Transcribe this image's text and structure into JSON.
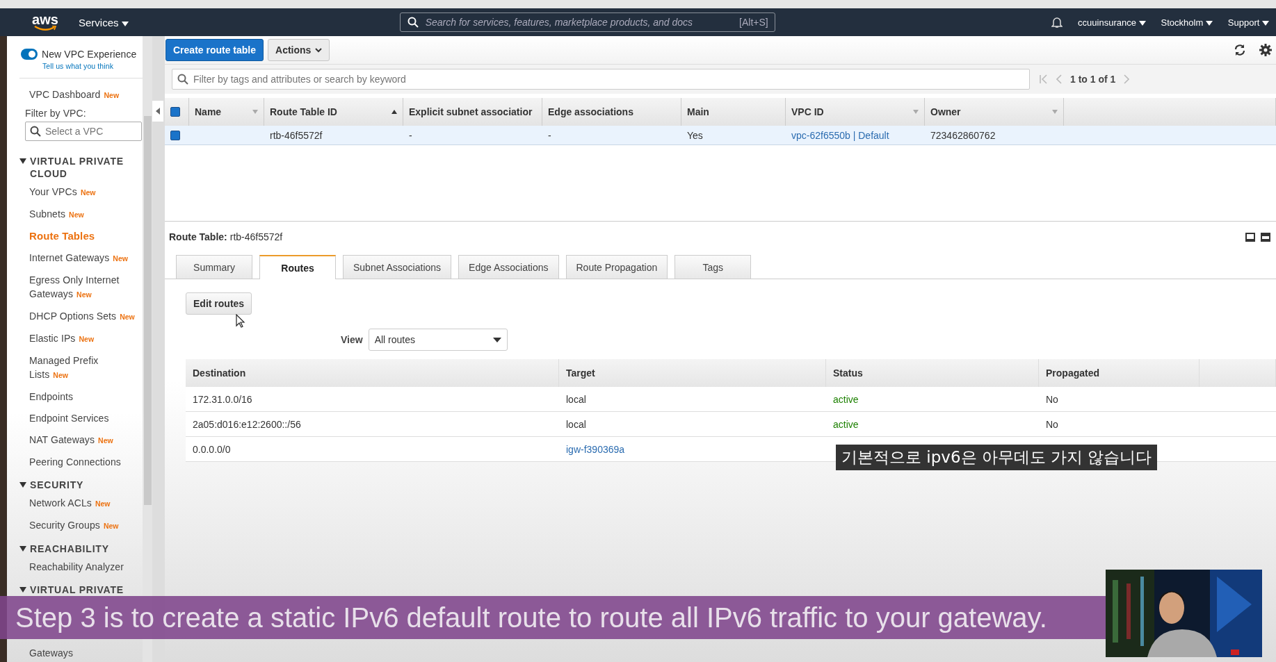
{
  "nav": {
    "logo": "aws",
    "services": "Services",
    "search": {
      "placeholder": "Search for services, features, marketplace products, and docs",
      "shortcut": "[Alt+S]"
    },
    "menus": [
      "ccuuinsurance",
      "Stockholm",
      "Support"
    ]
  },
  "sidebar": {
    "toggle": {
      "label": "New VPC Experience",
      "on": true
    },
    "feedback_link": "Tell us what you think",
    "items": [
      {
        "kind": "link",
        "label": "VPC Dashboard",
        "badge": "New",
        "selected": false
      },
      {
        "kind": "label",
        "label": "Filter by VPC:"
      },
      {
        "kind": "filter",
        "placeholder": "Select a VPC"
      },
      {
        "kind": "section",
        "label": "VIRTUAL PRIVATE CLOUD",
        "expanded": true
      },
      {
        "kind": "link",
        "label": "Your VPCs",
        "badge": "New",
        "selected": false
      },
      {
        "kind": "link",
        "label": "Subnets",
        "badge": "New",
        "selected": false
      },
      {
        "kind": "link",
        "label": "Route Tables",
        "selected": true
      },
      {
        "kind": "link",
        "label": "Internet Gateways",
        "badge": "New",
        "selected": false
      },
      {
        "kind": "link",
        "label": "Egress Only Internet Gateways",
        "badge": "New",
        "selected": false
      },
      {
        "kind": "link",
        "label": "DHCP Options Sets",
        "badge": "New",
        "selected": false
      },
      {
        "kind": "link",
        "label": "Elastic IPs",
        "badge": "New",
        "selected": false
      },
      {
        "kind": "link",
        "label": "Managed Prefix Lists",
        "badge": "New",
        "selected": false
      },
      {
        "kind": "link",
        "label": "Endpoints",
        "selected": false
      },
      {
        "kind": "link",
        "label": "Endpoint Services",
        "selected": false
      },
      {
        "kind": "link",
        "label": "NAT Gateways",
        "badge": "New",
        "selected": false
      },
      {
        "kind": "link",
        "label": "Peering Connections",
        "selected": false
      },
      {
        "kind": "section",
        "label": "SECURITY",
        "expanded": true
      },
      {
        "kind": "link",
        "label": "Network ACLs",
        "badge": "New",
        "selected": false
      },
      {
        "kind": "link",
        "label": "Security Groups",
        "badge": "New",
        "selected": false
      },
      {
        "kind": "section",
        "label": "REACHABILITY",
        "expanded": true
      },
      {
        "kind": "link",
        "label": "Reachability Analyzer",
        "selected": false
      },
      {
        "kind": "section",
        "label": "VIRTUAL PRIVATE",
        "expanded": true
      },
      {
        "kind": "link",
        "label": "Gateways",
        "selected": false
      }
    ]
  },
  "toolbar": {
    "create_button": "Create route table",
    "actions_button": "Actions"
  },
  "filter": {
    "placeholder": "Filter by tags and attributes or search by keyword",
    "pager": "1 to 1 of 1"
  },
  "table": {
    "all_checked": true,
    "columns": [
      {
        "label": "Name",
        "sortable": true,
        "sorted": false
      },
      {
        "label": "Route Table ID",
        "sortable": true,
        "sorted": true
      },
      {
        "label": "Explicit subnet associatior",
        "sortable": false
      },
      {
        "label": "Edge associations",
        "sortable": false
      },
      {
        "label": "Main",
        "sortable": false
      },
      {
        "label": "VPC ID",
        "sortable": true,
        "sorted": false
      },
      {
        "label": "Owner",
        "sortable": true,
        "sorted": false
      }
    ],
    "rows": [
      {
        "selected": true,
        "checked": true,
        "cells": [
          "",
          "rtb-46f5572f",
          "-",
          "-",
          "Yes",
          "vpc-62f6550b | Default",
          "723462860762"
        ]
      }
    ]
  },
  "details": {
    "label": "Route Table:",
    "value": "rtb-46f5572f",
    "tabs": [
      {
        "label": "Summary",
        "selected": false
      },
      {
        "label": "Routes",
        "selected": true
      },
      {
        "label": "Subnet Associations",
        "selected": false
      },
      {
        "label": "Edge Associations",
        "selected": false
      },
      {
        "label": "Route Propagation",
        "selected": false
      },
      {
        "label": "Tags",
        "selected": false
      }
    ],
    "edit_button": "Edit routes",
    "view_label": "View",
    "view_value": "All routes",
    "routes": {
      "columns": [
        "Destination",
        "Target",
        "Status",
        "Propagated"
      ],
      "rows": [
        {
          "destination": "172.31.0.0/16",
          "target": "local",
          "target_link": false,
          "status": "active",
          "propagated": "No"
        },
        {
          "destination": "2a05:d016:e12:2600::/56",
          "target": "local",
          "target_link": false,
          "status": "active",
          "propagated": "No"
        },
        {
          "destination": "0.0.0.0/0",
          "target": "igw-f390369a",
          "target_link": true
        }
      ]
    }
  },
  "captions": [
    {
      "kind": "box",
      "text": "기본적으로 ipv6은 아무데도 가지 않습니다"
    },
    {
      "kind": "band",
      "text": "Step 3 is to create a static IPv6 default route to route all IPv6 traffic to your gateway."
    }
  ]
}
